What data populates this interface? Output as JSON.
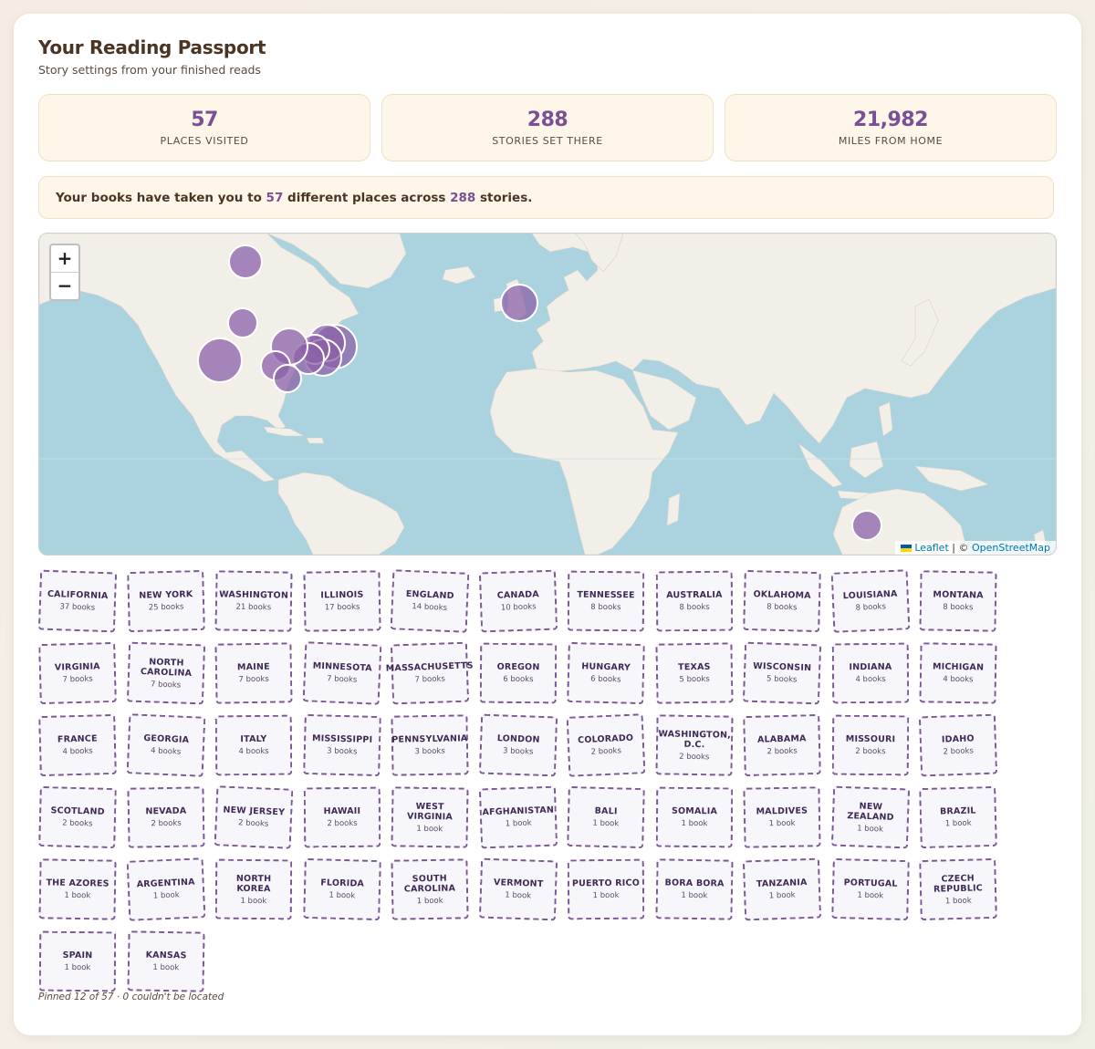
{
  "header": {
    "title": "Your Reading Passport",
    "subtitle": "Story settings from your finished reads"
  },
  "stats": [
    {
      "value": "57",
      "label": "PLACES VISITED"
    },
    {
      "value": "288",
      "label": "STORIES SET THERE"
    },
    {
      "value": "21,982",
      "label": "MILES FROM HOME"
    }
  ],
  "summary": {
    "prefix": "Your books have taken you to ",
    "places": "57",
    "middle": " different places across ",
    "stories": "288",
    "suffix": " stories."
  },
  "map": {
    "zoom_in": "+",
    "zoom_out": "−",
    "attribution_leaflet": "Leaflet",
    "attribution_sep": " | © ",
    "attribution_osm": "OpenStreetMap",
    "colors": {
      "water": "#aad3df",
      "land": "#f2efe9",
      "marker": "#8b62a8",
      "marker_stroke": "#ffffff"
    }
  },
  "stamps": [
    {
      "name": "California",
      "count": "37 books"
    },
    {
      "name": "New York",
      "count": "25 books"
    },
    {
      "name": "Washington",
      "count": "21 books"
    },
    {
      "name": "Illinois",
      "count": "17 books"
    },
    {
      "name": "England",
      "count": "14 books"
    },
    {
      "name": "Canada",
      "count": "10 books"
    },
    {
      "name": "Tennessee",
      "count": "8 books"
    },
    {
      "name": "Australia",
      "count": "8 books"
    },
    {
      "name": "Oklahoma",
      "count": "8 books"
    },
    {
      "name": "Louisiana",
      "count": "8 books"
    },
    {
      "name": "Montana",
      "count": "8 books"
    },
    {
      "name": "Virginia",
      "count": "7 books"
    },
    {
      "name": "North Carolina",
      "count": "7 books"
    },
    {
      "name": "Maine",
      "count": "7 books"
    },
    {
      "name": "Minnesota",
      "count": "7 books"
    },
    {
      "name": "Massachusetts",
      "count": "7 books"
    },
    {
      "name": "Oregon",
      "count": "6 books"
    },
    {
      "name": "Hungary",
      "count": "6 books"
    },
    {
      "name": "Texas",
      "count": "5 books"
    },
    {
      "name": "Wisconsin",
      "count": "5 books"
    },
    {
      "name": "Indiana",
      "count": "4 books"
    },
    {
      "name": "Michigan",
      "count": "4 books"
    },
    {
      "name": "France",
      "count": "4 books"
    },
    {
      "name": "Georgia",
      "count": "4 books"
    },
    {
      "name": "Italy",
      "count": "4 books"
    },
    {
      "name": "Mississippi",
      "count": "3 books"
    },
    {
      "name": "Pennsylvania",
      "count": "3 books"
    },
    {
      "name": "London",
      "count": "3 books"
    },
    {
      "name": "Colorado",
      "count": "2 books"
    },
    {
      "name": "Washington, D.C.",
      "count": "2 books"
    },
    {
      "name": "Alabama",
      "count": "2 books"
    },
    {
      "name": "Missouri",
      "count": "2 books"
    },
    {
      "name": "Idaho",
      "count": "2 books"
    },
    {
      "name": "Scotland",
      "count": "2 books"
    },
    {
      "name": "Nevada",
      "count": "2 books"
    },
    {
      "name": "New Jersey",
      "count": "2 books"
    },
    {
      "name": "Hawaii",
      "count": "2 books"
    },
    {
      "name": "West Virginia",
      "count": "1 book"
    },
    {
      "name": "Afghanistan",
      "count": "1 book"
    },
    {
      "name": "Bali",
      "count": "1 book"
    },
    {
      "name": "Somalia",
      "count": "1 book"
    },
    {
      "name": "Maldives",
      "count": "1 book"
    },
    {
      "name": "New Zealand",
      "count": "1 book"
    },
    {
      "name": "Brazil",
      "count": "1 book"
    },
    {
      "name": "The Azores",
      "count": "1 book"
    },
    {
      "name": "Argentina",
      "count": "1 book"
    },
    {
      "name": "North Korea",
      "count": "1 book"
    },
    {
      "name": "Florida",
      "count": "1 book"
    },
    {
      "name": "South Carolina",
      "count": "1 book"
    },
    {
      "name": "Vermont",
      "count": "1 book"
    },
    {
      "name": "Puerto Rico",
      "count": "1 book"
    },
    {
      "name": "Bora Bora",
      "count": "1 book"
    },
    {
      "name": "Tanzania",
      "count": "1 book"
    },
    {
      "name": "Portugal",
      "count": "1 book"
    },
    {
      "name": "Czech Republic",
      "count": "1 book"
    },
    {
      "name": "Spain",
      "count": "1 book"
    },
    {
      "name": "Kansas",
      "count": "1 book"
    }
  ],
  "footnote": "Pinned 12 of 57 · 0 couldn't be located"
}
